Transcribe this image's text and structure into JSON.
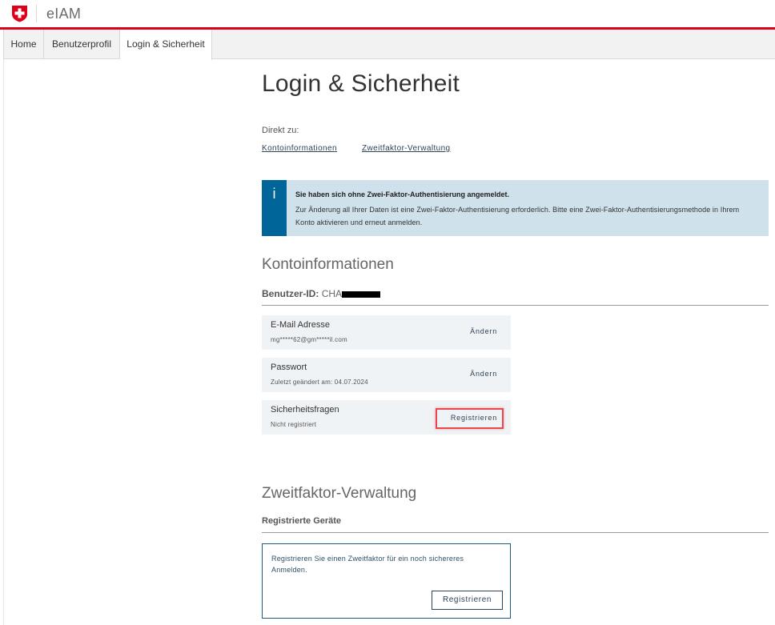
{
  "header": {
    "app_name": "eIAM",
    "logo_icon": "swiss-cross-icon",
    "accent_color": "#dc0018"
  },
  "tabs": [
    {
      "label": "Home",
      "active": false
    },
    {
      "label": "Benutzerprofil",
      "active": false
    },
    {
      "label": "Login & Sicherheit",
      "active": true
    }
  ],
  "page": {
    "title": "Login & Sicherheit",
    "jump_label": "Direkt zu:",
    "jump_links": [
      "Kontoinformationen",
      "Zweitfaktor-Verwaltung"
    ]
  },
  "alert": {
    "icon": "i",
    "title": "Sie haben sich ohne Zwei-Faktor-Authentisierung angemeldet.",
    "body": "Zur Änderung all Ihrer Daten ist eine Zwei-Faktor-Authentisierung erforderlich. Bitte eine Zwei-Faktor-Authentisierungsmethode in Ihrem Konto aktivieren und erneut anmelden."
  },
  "konto": {
    "heading": "Kontoinformationen",
    "userid_label": "Benutzer-ID:",
    "userid_value": "CHA",
    "items": [
      {
        "label": "E-Mail Adresse",
        "sub": "mg*****62@gm*****il.com",
        "action": "Ändern"
      },
      {
        "label": "Passwort",
        "sub": "Zuletzt geändert am: 04.07.2024",
        "action": "Ändern"
      },
      {
        "label": "Sicherheitsfragen",
        "sub": "Nicht registriert",
        "action": "Registrieren"
      }
    ]
  },
  "zweitfaktor": {
    "heading": "Zweitfaktor-Verwaltung",
    "subheading": "Registrierte Geräte",
    "card_text": "Registrieren Sie einen Zweitfaktor für ein noch sichereres Anmelden.",
    "card_button": "Registrieren"
  }
}
